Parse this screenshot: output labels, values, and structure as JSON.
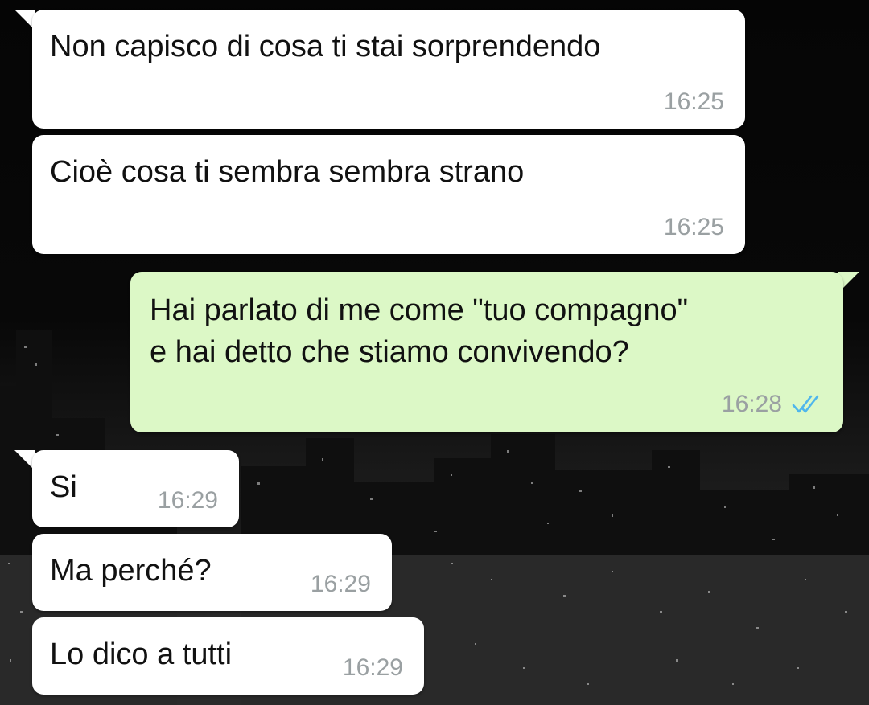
{
  "messages": [
    {
      "direction": "in",
      "text": "Non capisco di cosa ti stai sorprendendo",
      "time": "16:25"
    },
    {
      "direction": "in",
      "text": "Cioè cosa ti sembra sembra strano",
      "time": "16:25"
    },
    {
      "direction": "out",
      "lines": [
        "Hai parlato di me come \"tuo compagno\"",
        "e hai detto che stiamo convivendo?"
      ],
      "time": "16:28",
      "status": "read",
      "status_icon": "double-check-icon"
    },
    {
      "direction": "in",
      "text": "Si",
      "time": "16:29"
    },
    {
      "direction": "in",
      "text": "Ma perché?",
      "time": "16:29"
    },
    {
      "direction": "in",
      "text": "Lo dico a tutti",
      "time": "16:29"
    }
  ],
  "colors": {
    "incoming_bubble": "#ffffff",
    "outgoing_bubble": "#dcf8c6",
    "read_ticks": "#4fb6ec",
    "timestamp": "#9aa0a2"
  },
  "wallpaper": "night-city-skyline"
}
